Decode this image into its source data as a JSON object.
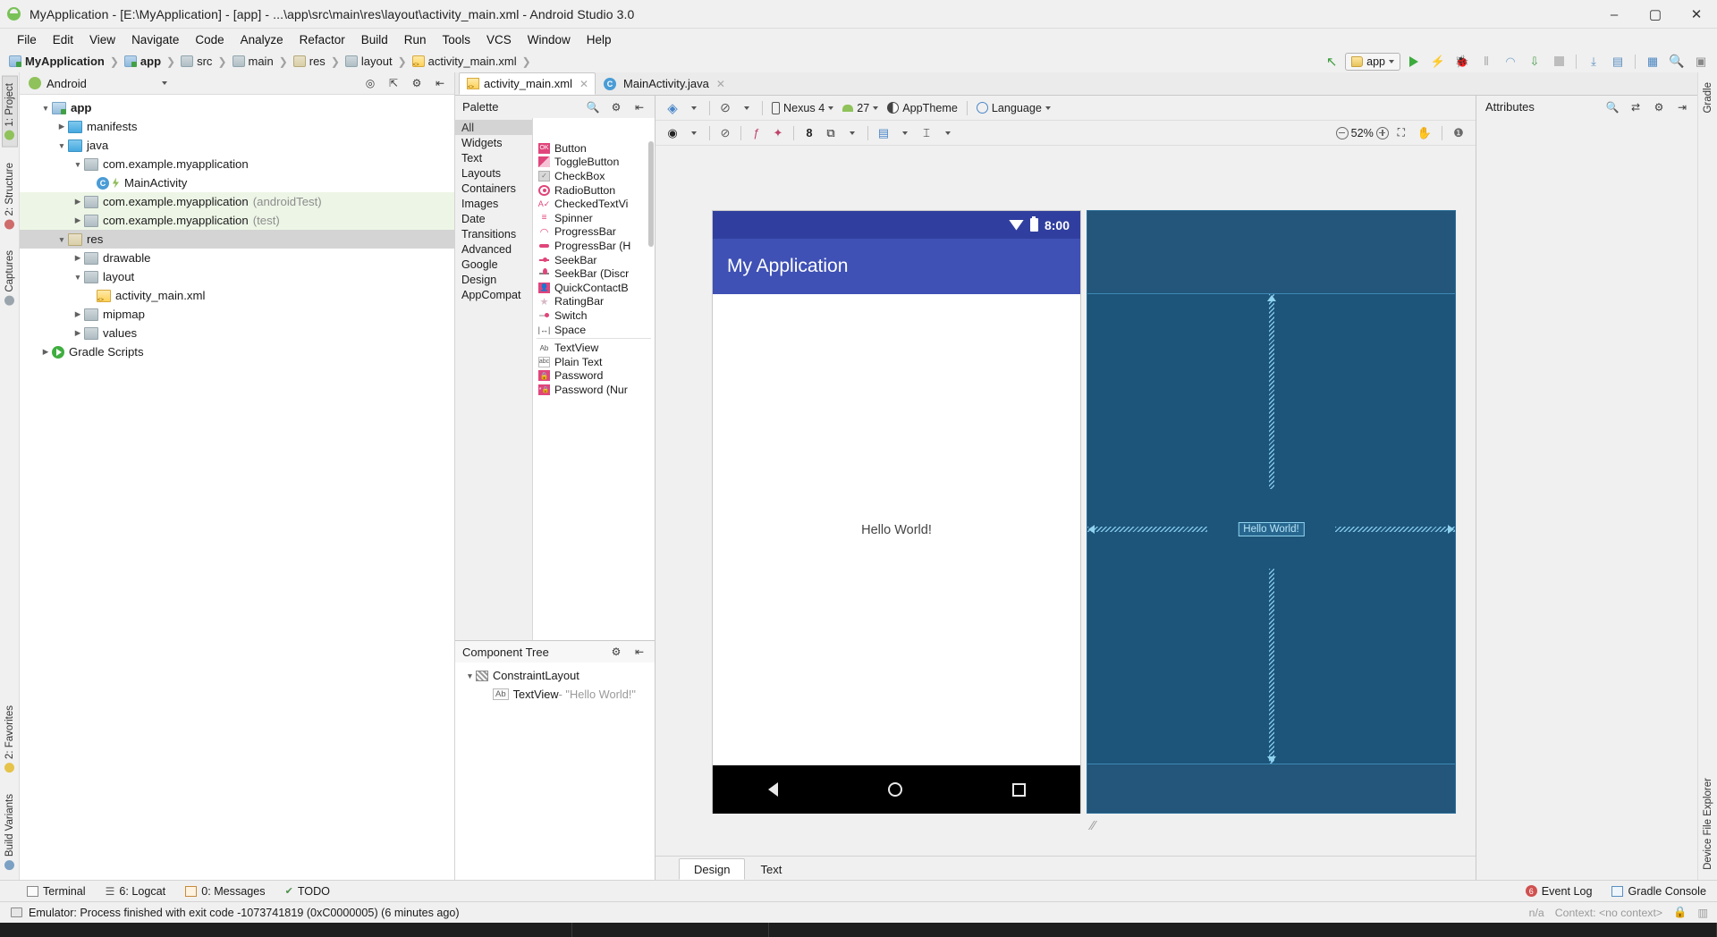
{
  "window": {
    "title": "MyApplication - [E:\\MyApplication] - [app] - ...\\app\\src\\main\\res\\layout\\activity_main.xml - Android Studio 3.0",
    "minimize": "–",
    "maximize": "▢",
    "close": "✕"
  },
  "menu": [
    "File",
    "Edit",
    "View",
    "Navigate",
    "Code",
    "Analyze",
    "Refactor",
    "Build",
    "Run",
    "Tools",
    "VCS",
    "Window",
    "Help"
  ],
  "breadcrumb": [
    {
      "label": "MyApplication",
      "icon": "module-icon",
      "bold": true
    },
    {
      "label": "app",
      "icon": "module-icon",
      "bold": true
    },
    {
      "label": "src",
      "icon": "folder-icon",
      "bold": false
    },
    {
      "label": "main",
      "icon": "folder-icon",
      "bold": false
    },
    {
      "label": "res",
      "icon": "res-folder-icon",
      "bold": false
    },
    {
      "label": "layout",
      "icon": "folder-icon",
      "bold": false
    },
    {
      "label": "activity_main.xml",
      "icon": "xml-file-icon",
      "bold": false
    }
  ],
  "toolbar": {
    "run_config": "app",
    "buttons": [
      "make-project-icon",
      "run-icon",
      "apply-changes-icon",
      "debug-icon",
      "profile-icon",
      "attach-debugger-icon",
      "stop-icon",
      "sdk-manager-icon",
      "avd-manager-icon",
      "layout-inspector-icon",
      "search-icon",
      "device-file-icon"
    ]
  },
  "left_strips": {
    "top": [
      "1: Project",
      "2: Structure",
      "Captures"
    ],
    "bottom": [
      "2: Favorites",
      "Build Variants"
    ]
  },
  "right_strips": {
    "top": [
      "Gradle"
    ],
    "bottom": [
      "Device File Explorer"
    ]
  },
  "project_panel": {
    "selector": "Android",
    "tree": [
      {
        "label": "app",
        "indent": 0,
        "arrow": "▼",
        "icon": "module-icon",
        "bold": true,
        "dim": "",
        "state": "normal"
      },
      {
        "label": "manifests",
        "indent": 1,
        "arrow": "▶",
        "icon": "folder-blue-icon",
        "bold": false,
        "dim": "",
        "state": "normal"
      },
      {
        "label": "java",
        "indent": 1,
        "arrow": "▼",
        "icon": "folder-blue-icon",
        "bold": false,
        "dim": "",
        "state": "normal"
      },
      {
        "label": "com.example.myapplication",
        "indent": 2,
        "arrow": "▼",
        "icon": "package-icon",
        "bold": false,
        "dim": "",
        "state": "normal"
      },
      {
        "label": "MainActivity",
        "indent": 3,
        "arrow": "",
        "icon": "java-class-icon",
        "bold": false,
        "dim": "",
        "state": "normal"
      },
      {
        "label": "com.example.myapplication",
        "indent": 2,
        "arrow": "▶",
        "icon": "package-icon",
        "bold": false,
        "dim": "(androidTest)",
        "state": "greenish"
      },
      {
        "label": "com.example.myapplication",
        "indent": 2,
        "arrow": "▶",
        "icon": "package-icon",
        "bold": false,
        "dim": "(test)",
        "state": "greenish"
      },
      {
        "label": "res",
        "indent": 1,
        "arrow": "▼",
        "icon": "res-folder-icon",
        "bold": false,
        "dim": "",
        "state": "selected"
      },
      {
        "label": "drawable",
        "indent": 2,
        "arrow": "▶",
        "icon": "package-icon",
        "bold": false,
        "dim": "",
        "state": "normal"
      },
      {
        "label": "layout",
        "indent": 2,
        "arrow": "▼",
        "icon": "package-icon",
        "bold": false,
        "dim": "",
        "state": "normal"
      },
      {
        "label": "activity_main.xml",
        "indent": 3,
        "arrow": "",
        "icon": "xml-file-icon",
        "bold": false,
        "dim": "",
        "state": "normal"
      },
      {
        "label": "mipmap",
        "indent": 2,
        "arrow": "▶",
        "icon": "package-icon",
        "bold": false,
        "dim": "",
        "state": "normal"
      },
      {
        "label": "values",
        "indent": 2,
        "arrow": "▶",
        "icon": "package-icon",
        "bold": false,
        "dim": "",
        "state": "normal"
      },
      {
        "label": "Gradle Scripts",
        "indent": 0,
        "arrow": "▶",
        "icon": "gradle-icon",
        "bold": false,
        "dim": "",
        "state": "normal"
      }
    ]
  },
  "editor_tabs": [
    {
      "label": "activity_main.xml",
      "icon": "xml-file-icon",
      "active": true
    },
    {
      "label": "MainActivity.java",
      "icon": "java-class-icon",
      "active": false
    }
  ],
  "palette": {
    "title": "Palette",
    "categories": [
      "All",
      "Widgets",
      "Text",
      "Layouts",
      "Containers",
      "Images",
      "Date",
      "Transitions",
      "Advanced",
      "Google",
      "Design",
      "AppCompat"
    ],
    "selected_category": "All",
    "items": [
      {
        "label": "Button",
        "icon": "button-icon"
      },
      {
        "label": "ToggleButton",
        "icon": "toggle-button-icon"
      },
      {
        "label": "CheckBox",
        "icon": "checkbox-icon"
      },
      {
        "label": "RadioButton",
        "icon": "radio-button-icon"
      },
      {
        "label": "CheckedTextVi",
        "icon": "checked-text-view-icon"
      },
      {
        "label": "Spinner",
        "icon": "spinner-icon"
      },
      {
        "label": "ProgressBar",
        "icon": "progress-bar-icon"
      },
      {
        "label": "ProgressBar (H",
        "icon": "progress-bar-horizontal-icon"
      },
      {
        "label": "SeekBar",
        "icon": "seekbar-icon"
      },
      {
        "label": "SeekBar (Discr",
        "icon": "seekbar-discrete-icon"
      },
      {
        "label": "QuickContactB",
        "icon": "quick-contact-badge-icon"
      },
      {
        "label": "RatingBar",
        "icon": "rating-bar-icon"
      },
      {
        "label": "Switch",
        "icon": "switch-icon"
      },
      {
        "label": "Space",
        "icon": "space-icon"
      },
      {
        "label": "TextView",
        "icon": "text-view-icon"
      },
      {
        "label": "Plain Text",
        "icon": "plain-text-icon"
      },
      {
        "label": "Password",
        "icon": "password-icon"
      },
      {
        "label": "Password (Nur",
        "icon": "password-numeric-icon"
      }
    ]
  },
  "component_tree": {
    "title": "Component Tree",
    "nodes": [
      {
        "label": "ConstraintLayout",
        "icon": "constraint-layout-icon",
        "arrow": "▼",
        "indent": 0,
        "suffix": ""
      },
      {
        "label": "TextView",
        "icon": "text-view-icon",
        "arrow": "",
        "indent": 1,
        "suffix": " - \"Hello World!\""
      }
    ]
  },
  "design_toolbar": {
    "device": "Nexus 4",
    "api": "27",
    "theme": "AppTheme",
    "language": "Language",
    "layers_icon": "layers-icon",
    "orientation_icon": "orientation-icon",
    "device_icon": "phone-icon",
    "api_icon": "android-icon",
    "theme_icon": "theme-icon",
    "language_icon": "globe-icon"
  },
  "constraint_toolbar": {
    "visibility_icon": "eye-icon",
    "autoconnect_icon": "autoconnect-off-icon",
    "clear_constraints_icon": "clear-constraints-icon",
    "infer_constraints_icon": "magic-wand-icon",
    "default_margin": "8",
    "pack_icon": "pack-icon",
    "align_icon": "align-icon",
    "guidelines_icon": "guidelines-icon",
    "zoom_level": "52%",
    "zoom_out_icon": "zoom-out-icon",
    "zoom_in_icon": "zoom-in-icon",
    "zoom_fit_icon": "zoom-to-fit-icon",
    "pan_icon": "pan-hand-icon",
    "issues_icon": "issues-icon"
  },
  "preview": {
    "status_time": "8:00",
    "wifi_icon": "wifi-icon",
    "battery_icon": "battery-icon",
    "app_bar_title": "My Application",
    "content_text": "Hello World!",
    "nav_back_icon": "nav-back-icon",
    "nav_home_icon": "nav-home-icon",
    "nav_recents_icon": "nav-recents-icon",
    "blueprint_label": "Hello World!",
    "app_bar_color": "#3f51b5",
    "status_bar_color": "#303f9f",
    "blueprint_color": "#1d5479"
  },
  "design_text_tabs": [
    {
      "label": "Design",
      "active": true
    },
    {
      "label": "Text",
      "active": false
    }
  ],
  "attributes": {
    "title": "Attributes",
    "search_icon": "search-icon",
    "expand_icon": "expand-icon",
    "settings_icon": "gear-icon",
    "collapse_icon": "collapse-icon"
  },
  "tool_windows": [
    {
      "label": "Terminal",
      "icon": "terminal-icon"
    },
    {
      "label": "6: Logcat",
      "icon": "logcat-icon"
    },
    {
      "label": "0: Messages",
      "icon": "messages-icon"
    },
    {
      "label": "TODO",
      "icon": "todo-icon"
    }
  ],
  "tool_windows_right": [
    {
      "label": "Event Log",
      "icon": "event-log-icon",
      "badge": "6"
    },
    {
      "label": "Gradle Console",
      "icon": "gradle-console-icon",
      "badge": ""
    }
  ],
  "status_bar": {
    "message": "Emulator: Process finished with exit code -1073741819 (0xC0000005) (6 minutes ago)",
    "icon": "monitor-icon",
    "position": "n/a",
    "context": "Context: <no context>",
    "lock_icon": "lock-icon",
    "memory_icon": "memory-icon"
  }
}
